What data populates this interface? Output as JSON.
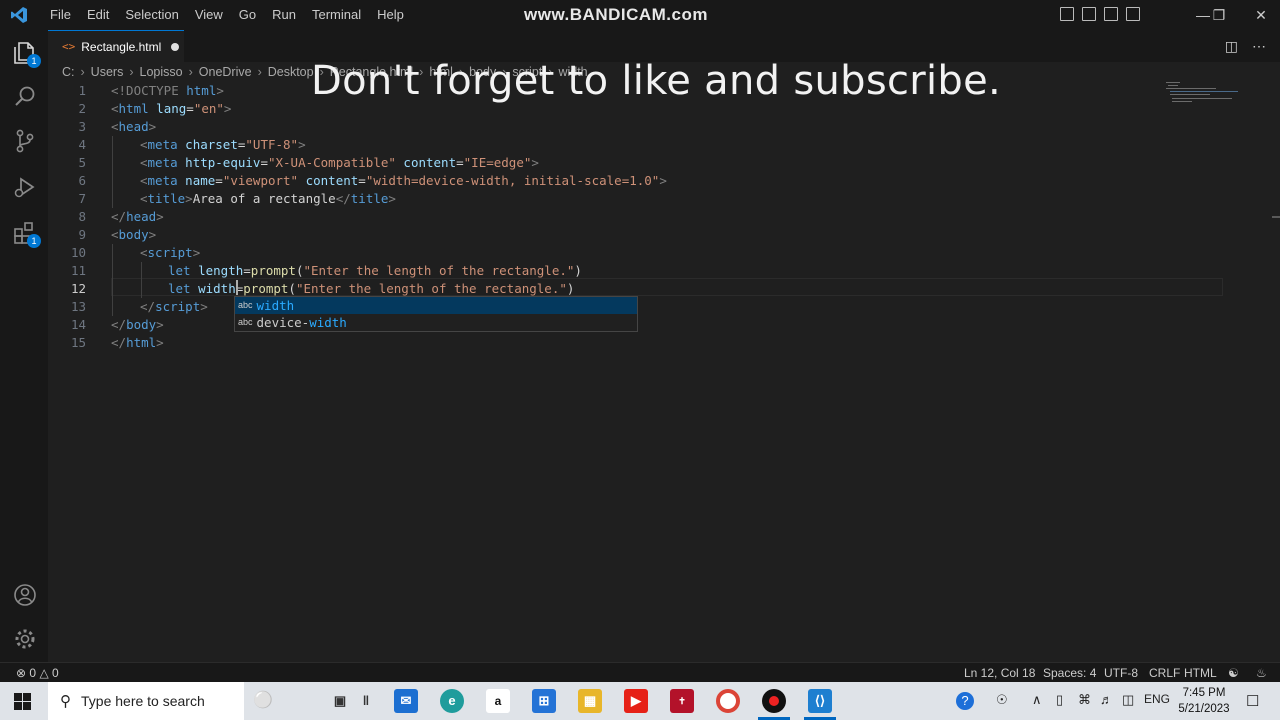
{
  "menu": [
    "File",
    "Edit",
    "Selection",
    "View",
    "Go",
    "Run",
    "Terminal",
    "Help"
  ],
  "watermark": "www.BANDICAM.com",
  "tab": {
    "icon": "<>",
    "name": "Rectangle.html"
  },
  "breadcrumb": [
    "C:",
    "Users",
    "Lopisso",
    "OneDrive",
    "Desktop",
    "Rectangle.html",
    "html",
    "body",
    "script",
    "width"
  ],
  "caption": "Don't forget to like and subscribe.",
  "activity_badges": {
    "explorer": "1",
    "extensions": "1"
  },
  "line_numbers": [
    "1",
    "2",
    "3",
    "4",
    "5",
    "6",
    "7",
    "8",
    "9",
    "10",
    "11",
    "12",
    "13",
    "14",
    "15"
  ],
  "active_line": "12",
  "code": {
    "l1": [
      "<!DOCTYPE",
      " html",
      ">"
    ],
    "l2": [
      "<",
      "html",
      " lang",
      "=",
      "\"en\"",
      ">"
    ],
    "l3": [
      "<",
      "head",
      ">"
    ],
    "l4": [
      "<",
      "meta",
      " charset",
      "=",
      "\"UTF-8\"",
      ">"
    ],
    "l5": [
      "<",
      "meta",
      " http-equiv",
      "=",
      "\"X-UA-Compatible\"",
      " content",
      "=",
      "\"IE=edge\"",
      ">"
    ],
    "l6": [
      "<",
      "meta",
      " name",
      "=",
      "\"viewport\"",
      " content",
      "=",
      "\"width=device-width, initial-scale=1.0\"",
      ">"
    ],
    "l7": [
      "<",
      "title",
      ">",
      "Area of a rectangle",
      "</",
      "title",
      ">"
    ],
    "l8": [
      "</",
      "head",
      ">"
    ],
    "l9": [
      "<",
      "body",
      ">"
    ],
    "l10": [
      "<",
      "script",
      ">"
    ],
    "l11": [
      "let",
      " length",
      "=",
      "prompt",
      "(",
      "\"Enter the length of the rectangle.\"",
      ")"
    ],
    "l12": [
      "let",
      " width",
      "=",
      "prompt",
      "(",
      "\"Enter the length of the rectangle.\"",
      ")"
    ],
    "l13": [
      "</",
      "script",
      ">"
    ],
    "l14": [
      "</",
      "body",
      ">"
    ],
    "l15": [
      "</",
      "html",
      ">"
    ]
  },
  "suggestions": [
    {
      "kind": "abc",
      "prefix": "",
      "match": "width",
      "selected": true
    },
    {
      "kind": "abc",
      "prefix": "device-",
      "match": "width",
      "selected": false
    }
  ],
  "status": {
    "errors": "0",
    "warnings": "0",
    "position": "Ln 12, Col 18",
    "spaces": "Spaces: 4",
    "encoding": "UTF-8",
    "eol": "CRLF",
    "language": "HTML"
  },
  "taskbar": {
    "search_placeholder": "Type here to search",
    "language": "ENG",
    "time": "7:45 PM",
    "date": "5/21/2023"
  },
  "colors": {
    "accent": "#0078d4",
    "tab_icon": "#e37933",
    "tag": "#569cd6",
    "attr": "#9cdcfe",
    "string": "#ce9178"
  }
}
